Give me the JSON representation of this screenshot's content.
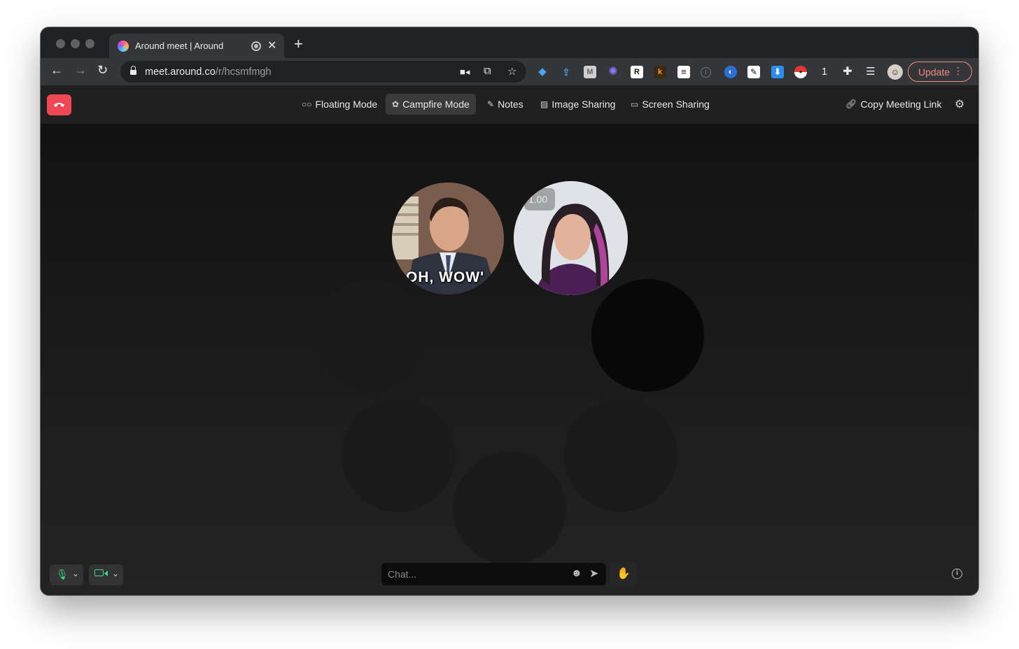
{
  "browser": {
    "tab": {
      "title": "Around meet | Around",
      "favicon": "around-logo-icon",
      "close": "✕"
    },
    "new_tab": "+",
    "url_host": "meet.around.co",
    "url_path": "/r/hcsmfmgh",
    "extension_badge_count": "1",
    "update_label": "Update",
    "menu_glyph": "⋮"
  },
  "app": {
    "modes": [
      {
        "label": "Floating Mode",
        "icon": "floating-mode-icon",
        "glyph": "○○"
      },
      {
        "label": "Campfire Mode",
        "icon": "campfire-mode-icon",
        "glyph": "✿",
        "active": true
      },
      {
        "label": "Notes",
        "icon": "notes-icon",
        "glyph": "✎"
      },
      {
        "label": "Image Sharing",
        "icon": "image-icon",
        "glyph": "▨"
      },
      {
        "label": "Screen Sharing",
        "icon": "screen-icon",
        "glyph": "▭"
      }
    ],
    "copy_link_label": "Copy Meeting Link",
    "colors": {
      "hangup": "#f04754",
      "update": "#f28b82",
      "mic_active": "#3ddc84"
    }
  },
  "stage": {
    "participants": [
      {
        "name": "participant-1",
        "caption": "OH, WOW'"
      },
      {
        "name": "participant-2",
        "zoom_label": "1.00"
      }
    ]
  },
  "controls": {
    "chat_placeholder": "Chat...",
    "emoji_glyph": "☻",
    "send_glyph": "➤",
    "raise_hand_glyph": "✋",
    "info_glyph": "i",
    "chevron": "⌄"
  }
}
